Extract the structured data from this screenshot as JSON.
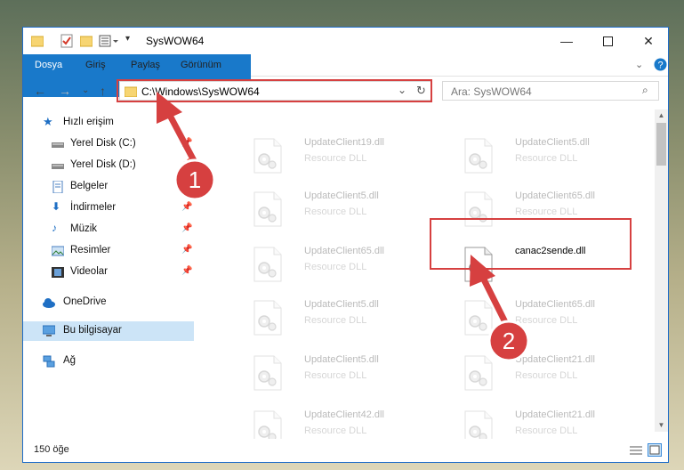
{
  "window": {
    "title": "SysWOW64"
  },
  "ribbon": {
    "tabs": [
      "Dosya",
      "Giriş",
      "Paylaş",
      "Görünüm"
    ]
  },
  "nav": {
    "address": "C:\\Windows\\SysWOW64",
    "search_placeholder": "Ara: SysWOW64"
  },
  "sidebar": {
    "items": [
      {
        "label": "Hızlı erişim",
        "icon": "star-icon"
      },
      {
        "label": "Yerel Disk (C:)",
        "icon": "drive-icon"
      },
      {
        "label": "Yerel Disk (D:)",
        "icon": "drive-icon"
      },
      {
        "label": "Belgeler",
        "icon": "documents-icon"
      },
      {
        "label": "İndirmeler",
        "icon": "download-icon"
      },
      {
        "label": "Müzik",
        "icon": "music-icon"
      },
      {
        "label": "Resimler",
        "icon": "pictures-icon"
      },
      {
        "label": "Videolar",
        "icon": "videos-icon"
      },
      {
        "label": "OneDrive",
        "icon": "cloud-icon"
      },
      {
        "label": "Bu bilgisayar",
        "icon": "computer-icon"
      },
      {
        "label": "Ağ",
        "icon": "network-icon"
      }
    ]
  },
  "files": [
    {
      "name": "UpdateClient19.dll",
      "type": "Resource DLL"
    },
    {
      "name": "UpdateClient5.dll",
      "type": "Resource DLL"
    },
    {
      "name": "UpdateClient5.dll",
      "type": "Resource DLL"
    },
    {
      "name": "UpdateClient65.dll",
      "type": "Resource DLL"
    },
    {
      "name": "UpdateClient65.dll",
      "type": "Resource DLL"
    },
    {
      "name": "canac2sende.dll",
      "type": ""
    },
    {
      "name": "UpdateClient5.dll",
      "type": "Resource DLL"
    },
    {
      "name": "UpdateClient65.dll",
      "type": "Resource DLL"
    },
    {
      "name": "UpdateClient5.dll",
      "type": "Resource DLL"
    },
    {
      "name": "UpdateClient21.dll",
      "type": "Resource DLL"
    },
    {
      "name": "UpdateClient42.dll",
      "type": "Resource DLL"
    },
    {
      "name": "UpdateClient21.dll",
      "type": "Resource DLL"
    }
  ],
  "status": {
    "count_text": "150 öğe"
  },
  "callouts": [
    "1",
    "2"
  ],
  "colors": {
    "accent": "#1979ca",
    "highlight": "#d64040",
    "selected": "#cce4f7"
  }
}
